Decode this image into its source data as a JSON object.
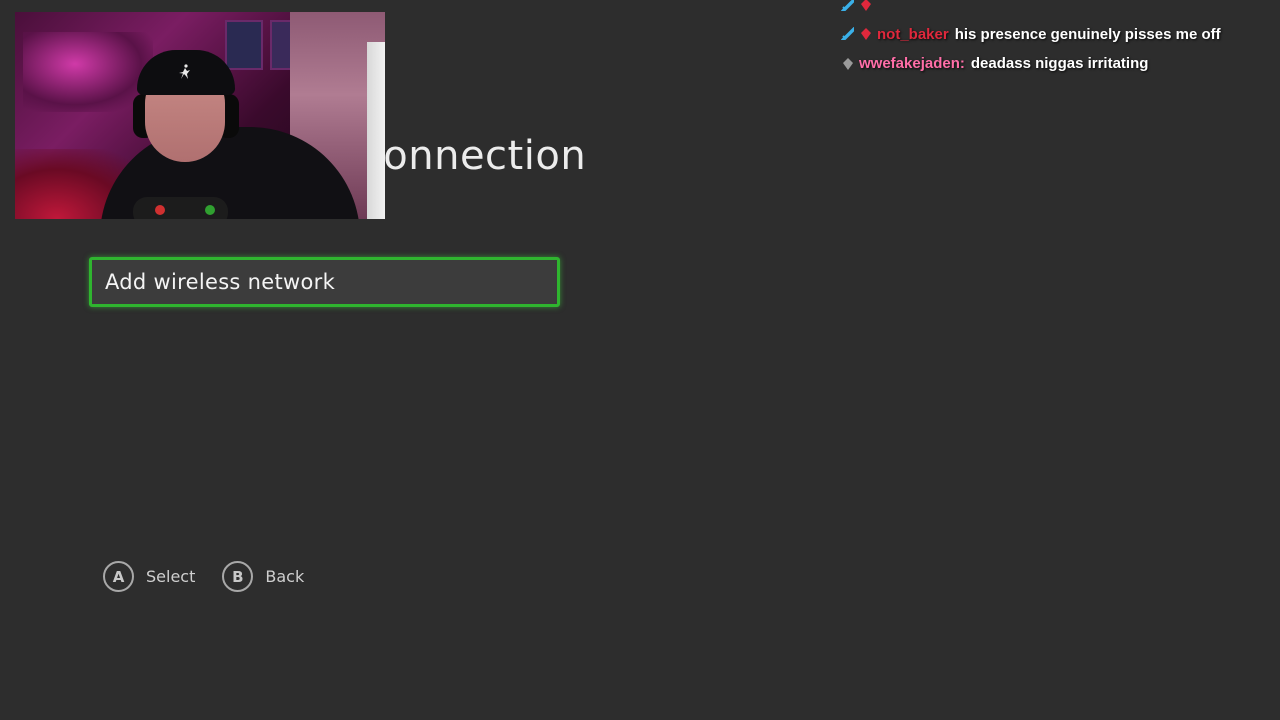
{
  "page": {
    "title": "Add wireless connection",
    "title_visible_fragment": "ection"
  },
  "menu": {
    "items": [
      {
        "label": "Add wireless network",
        "focused": true
      }
    ],
    "focus_color": "#2fb52f"
  },
  "hints": [
    {
      "button": "A",
      "label": "Select"
    },
    {
      "button": "B",
      "label": "Back"
    }
  ],
  "chat": {
    "messages": [
      {
        "badges": [
          "sword-icon",
          "bits-icon"
        ],
        "username": "",
        "username_color": "#e0283c",
        "message": ""
      },
      {
        "badges": [
          "sword-icon",
          "bits-icon"
        ],
        "username": "not_baker",
        "username_color": "#e0283c",
        "message": "his presence genuinely pisses me off"
      },
      {
        "badges": [
          "bits-icon"
        ],
        "username": "wwefakejaden:",
        "username_color": "#ff6ea8",
        "message": "deadass niggas irritating"
      }
    ]
  },
  "webcam": {
    "cap_logo": "jumpman-icon"
  },
  "colors": {
    "background": "#2d2d2d",
    "accent": "#2fb52f"
  }
}
